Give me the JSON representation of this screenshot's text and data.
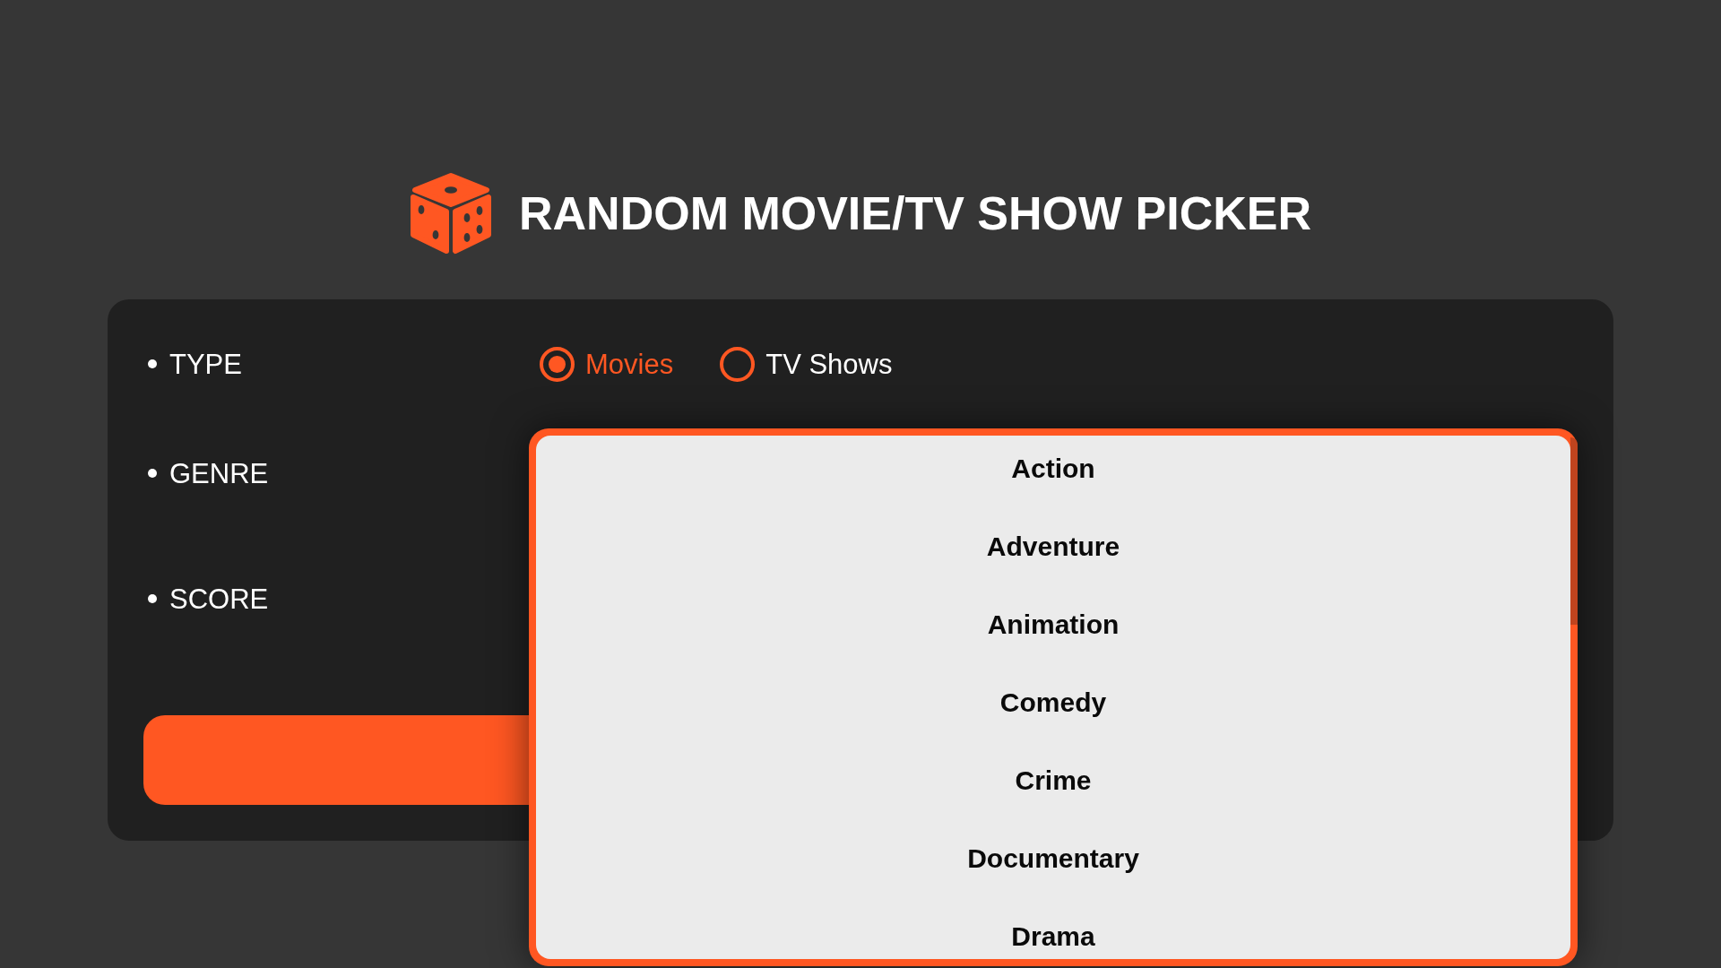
{
  "header": {
    "title": "RANDOM MOVIE/TV SHOW PICKER"
  },
  "form": {
    "fields": [
      {
        "label": "TYPE"
      },
      {
        "label": "GENRE"
      },
      {
        "label": "SCORE"
      }
    ],
    "type_options": [
      {
        "label": "Movies",
        "selected": true
      },
      {
        "label": "TV Shows",
        "selected": false
      }
    ],
    "genre_dropdown": {
      "options": [
        {
          "label": "Action",
          "selected": false
        },
        {
          "label": "Adventure",
          "selected": false
        },
        {
          "label": "Animation",
          "selected": false
        },
        {
          "label": "Comedy",
          "selected": false
        },
        {
          "label": "Crime",
          "selected": false
        },
        {
          "label": "Documentary",
          "selected": false
        },
        {
          "label": "Drama",
          "selected": false
        }
      ]
    }
  }
}
